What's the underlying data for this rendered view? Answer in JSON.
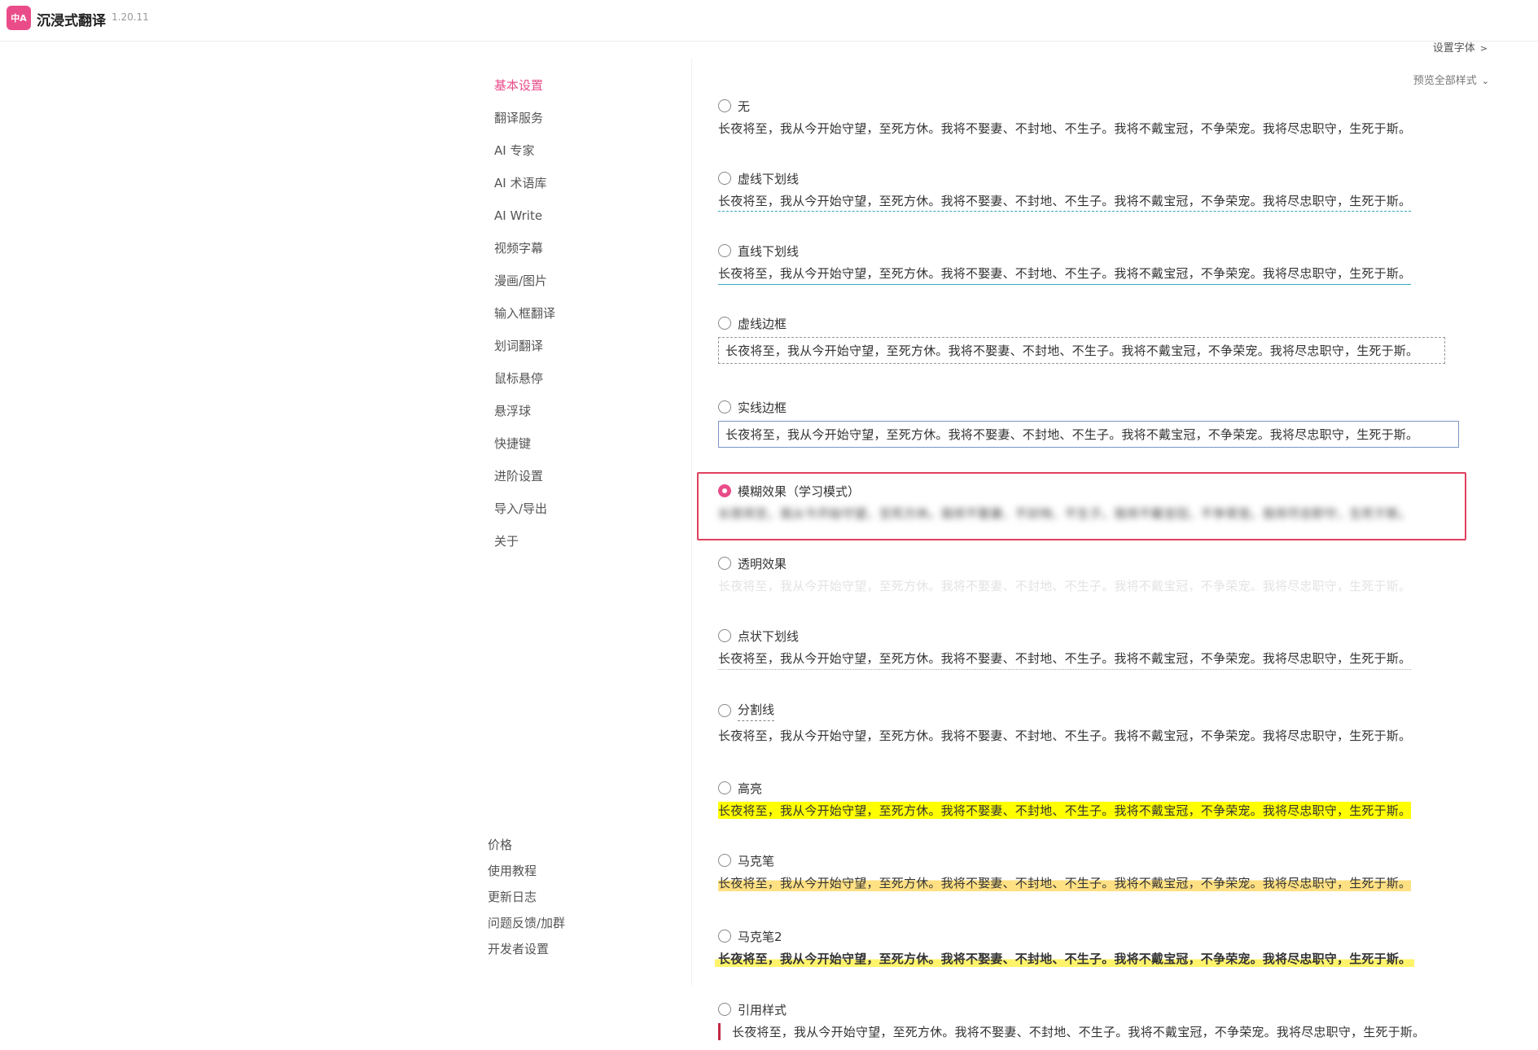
{
  "app": {
    "logo_text": "中A",
    "title": "沉浸式翻译",
    "version": "1.20.11"
  },
  "top_actions": {
    "settings_font": "设置字体",
    "preview_all": "预览全部样式"
  },
  "nav": {
    "items": [
      "基本设置",
      "翻译服务",
      "AI 专家",
      "AI 术语库",
      "AI Write",
      "视频字幕",
      "漫画/图片",
      "输入框翻译",
      "划词翻译",
      "鼠标悬停",
      "悬浮球",
      "快捷键",
      "进阶设置",
      "导入/导出",
      "关于"
    ],
    "active_index": 0,
    "bottom_links": [
      "价格",
      "使用教程",
      "更新日志",
      "问题反馈/加群",
      "开发者设置"
    ]
  },
  "sample_text": "长夜将至，我从今开始守望，至死方休。我将不娶妻、不封地、不生子。我将不戴宝冠，不争荣宠。我将尽忠职守，生死于斯。",
  "styles": [
    {
      "label": "无",
      "checked": false
    },
    {
      "label": "虚线下划线",
      "checked": false
    },
    {
      "label": "直线下划线",
      "checked": false
    },
    {
      "label": "虚线边框",
      "checked": false
    },
    {
      "label": "实线边框",
      "checked": false
    },
    {
      "label": "模糊效果（学习模式）",
      "checked": true
    },
    {
      "label": "透明效果",
      "checked": false
    },
    {
      "label": "点状下划线",
      "checked": false
    },
    {
      "label": "分割线",
      "checked": false
    },
    {
      "label": "高亮",
      "checked": false
    },
    {
      "label": "马克笔",
      "checked": false
    },
    {
      "label": "马克笔2",
      "checked": false
    },
    {
      "label": "引用样式",
      "checked": false
    }
  ],
  "colors": {
    "accent": "#ea4c89",
    "selection_frame": "#e0415f",
    "highlight": "#ffff00",
    "marker": "#ffe082",
    "quote_bar": "#c02a44"
  }
}
